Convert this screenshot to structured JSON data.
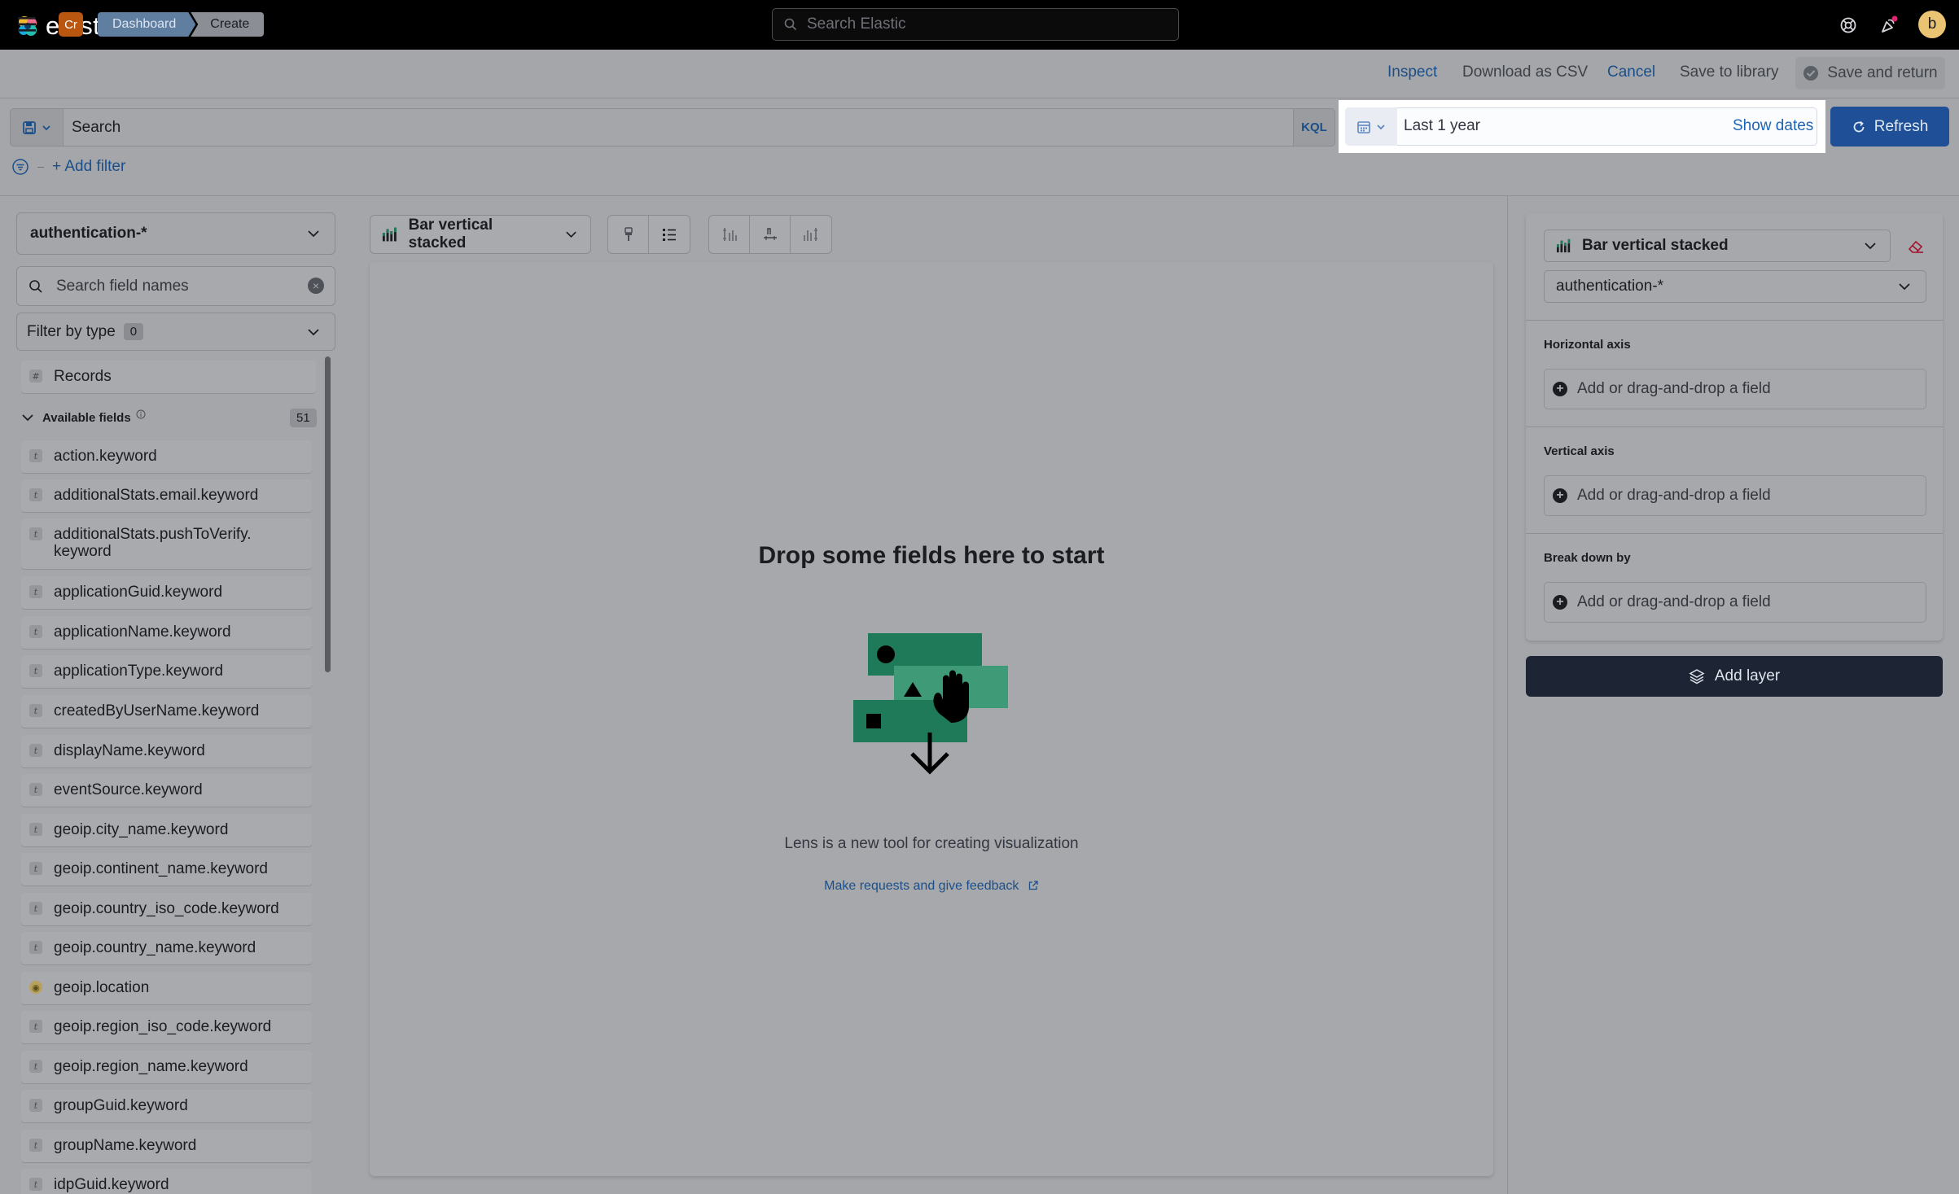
{
  "header": {
    "logo_text": "elastic",
    "search_placeholder": "Search Elastic",
    "user_initial": "b"
  },
  "nav": {
    "app_badge": "Cr",
    "breadcrumbs": [
      "Dashboard",
      "Create"
    ],
    "actions": {
      "inspect": "Inspect",
      "download_csv": "Download as CSV",
      "cancel": "Cancel",
      "save_library": "Save to library",
      "save_return": "Save and return"
    }
  },
  "query": {
    "placeholder": "Search",
    "language": "KQL",
    "date_range": "Last 1 year",
    "show_dates": "Show dates",
    "refresh": "Refresh",
    "add_filter": "+ Add filter"
  },
  "sidebar": {
    "index_pattern": "authentication-*",
    "search_placeholder": "Search field names",
    "filter_by_type": "Filter by type",
    "filter_count": "0",
    "records_label": "Records",
    "records_type": "#",
    "available_fields_label": "Available fields",
    "available_fields_count": "51",
    "fields": [
      {
        "name": "action.keyword",
        "type": "t"
      },
      {
        "name": "additionalStats.email.keyword",
        "type": "t"
      },
      {
        "name": "additionalStats.pushToVerify.\nkeyword",
        "type": "t"
      },
      {
        "name": "applicationGuid.keyword",
        "type": "t"
      },
      {
        "name": "applicationName.keyword",
        "type": "t"
      },
      {
        "name": "applicationType.keyword",
        "type": "t"
      },
      {
        "name": "createdByUserName.keyword",
        "type": "t"
      },
      {
        "name": "displayName.keyword",
        "type": "t"
      },
      {
        "name": "eventSource.keyword",
        "type": "t"
      },
      {
        "name": "geoip.city_name.keyword",
        "type": "t"
      },
      {
        "name": "geoip.continent_name.keyword",
        "type": "t"
      },
      {
        "name": "geoip.country_iso_code.keyword",
        "type": "t"
      },
      {
        "name": "geoip.country_name.keyword",
        "type": "t"
      },
      {
        "name": "geoip.location",
        "type": "geo"
      },
      {
        "name": "geoip.region_iso_code.keyword",
        "type": "t"
      },
      {
        "name": "geoip.region_name.keyword",
        "type": "t"
      },
      {
        "name": "groupGuid.keyword",
        "type": "t"
      },
      {
        "name": "groupName.keyword",
        "type": "t"
      },
      {
        "name": "idpGuid.keyword",
        "type": "t"
      }
    ]
  },
  "workspace": {
    "chart_type": "Bar vertical stacked",
    "drop_title": "Drop some fields here to start",
    "description": "Lens is a new tool for creating visualization",
    "feedback_link": "Make requests and give feedback"
  },
  "config": {
    "chart_type": "Bar vertical stacked",
    "index_pattern": "authentication-*",
    "horizontal_axis": "Horizontal axis",
    "vertical_axis": "Vertical axis",
    "break_down_by": "Break down by",
    "drop_placeholder": "Add or drag-and-drop a field",
    "add_layer": "Add layer"
  },
  "colors": {
    "header_bg": "#000000",
    "overlay_bg": "#a5a6a9",
    "primary": "#1f4f96",
    "link": "#1b4f8a",
    "add_layer_bg": "#1d2535",
    "illustration_green": "#1f7a5a"
  }
}
